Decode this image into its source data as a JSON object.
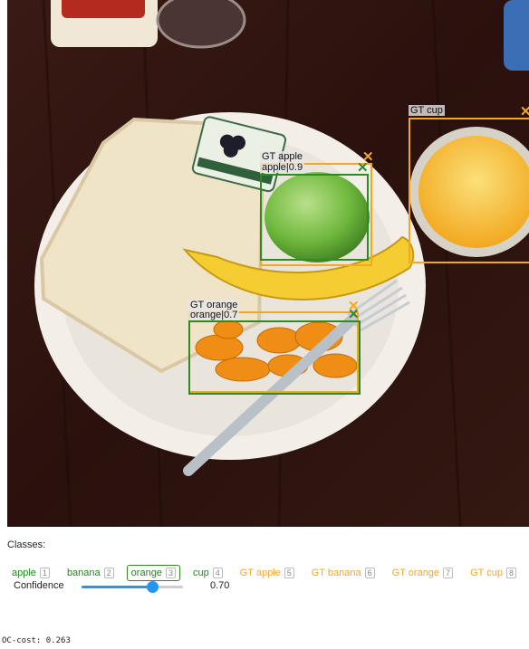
{
  "detections": {
    "cup": {
      "gt_label": "GT cup"
    },
    "apple": {
      "gt_label": "GT apple",
      "pred_label": "apple|0.9"
    },
    "orange": {
      "gt_label": "GT orange",
      "pred_label": "orange|0.7"
    }
  },
  "classes_title": "Classes:",
  "classes": [
    {
      "label": "apple",
      "key": "1",
      "kind": "pred"
    },
    {
      "label": "banana",
      "key": "2",
      "kind": "pred"
    },
    {
      "label": "orange",
      "key": "3",
      "kind": "pred",
      "selected": true
    },
    {
      "label": "cup",
      "key": "4",
      "kind": "pred"
    },
    {
      "label": "GT apple",
      "key": "5",
      "kind": "gt"
    },
    {
      "label": "GT banana",
      "key": "6",
      "kind": "gt"
    },
    {
      "label": "GT orange",
      "key": "7",
      "kind": "gt"
    },
    {
      "label": "GT cup",
      "key": "8",
      "kind": "gt"
    }
  ],
  "confidence": {
    "label": "Confidence",
    "value": 0.7,
    "value_text": "0.70"
  },
  "oc_cost": "OC-cost: 0.263",
  "colors": {
    "gt": "#f5a623",
    "pred": "#2e8b22",
    "slider": "#2196f3"
  }
}
